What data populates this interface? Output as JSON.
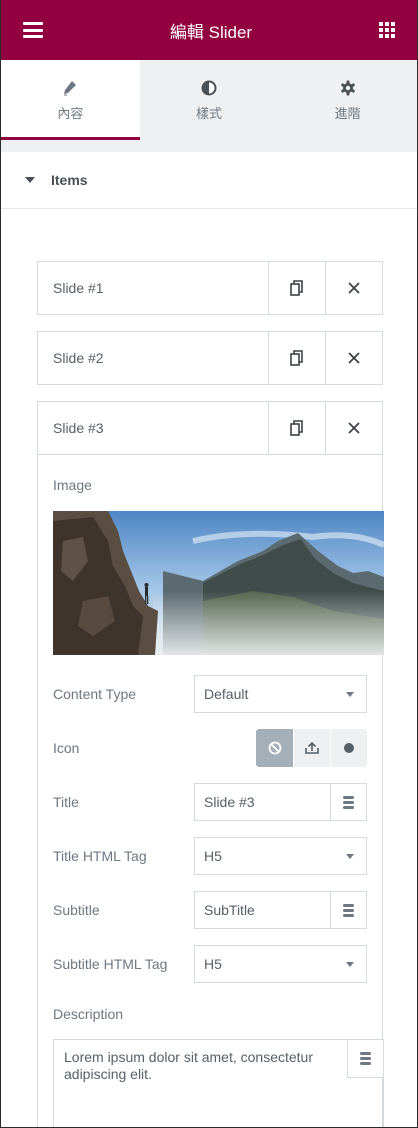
{
  "header": {
    "title": "編輯 Slider",
    "menu_icon": "hamburger-icon",
    "apps_icon": "grid-icon",
    "brand_color": "#93003f"
  },
  "tabs": [
    {
      "label": "內容",
      "icon": "pencil-icon",
      "active": true
    },
    {
      "label": "樣式",
      "icon": "half-circle-icon",
      "active": false
    },
    {
      "label": "進階",
      "icon": "gear-icon",
      "active": false
    }
  ],
  "section": {
    "label": "Items"
  },
  "slides": [
    {
      "title": "Slide #1"
    },
    {
      "title": "Slide #2"
    },
    {
      "title": "Slide #3"
    }
  ],
  "editor": {
    "image_label": "Image",
    "content_type_label": "Content Type",
    "content_type_value": "Default",
    "icon_label": "Icon",
    "title_label": "Title",
    "title_value": "Slide #3",
    "title_tag_label": "Title HTML Tag",
    "title_tag_value": "H5",
    "subtitle_label": "Subtitle",
    "subtitle_value": "SubTitle",
    "subtitle_tag_label": "Subtitle HTML Tag",
    "subtitle_tag_value": "H5",
    "description_label": "Description",
    "description_value": "Lorem ipsum dolor sit amet, consectetur adipiscing elit."
  }
}
